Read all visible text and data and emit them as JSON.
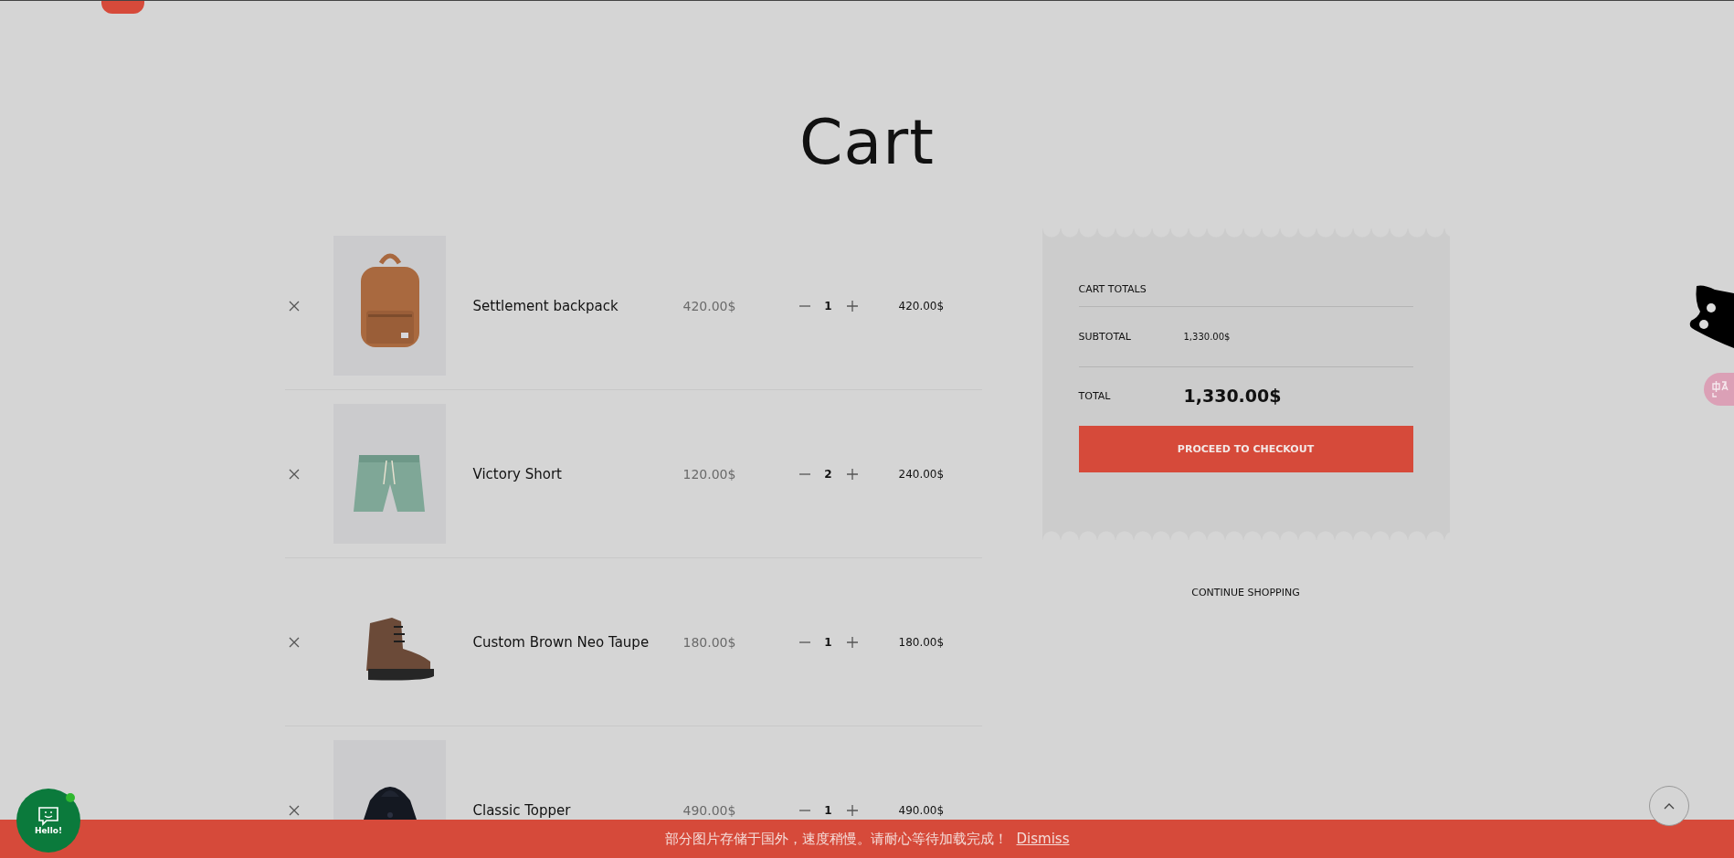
{
  "page": {
    "title": "Cart"
  },
  "cart_items": [
    {
      "name": "Settlement backpack",
      "price": "420.00$",
      "quantity": "1",
      "subtotal": "420.00$"
    },
    {
      "name": "Victory Short",
      "price": "120.00$",
      "quantity": "2",
      "subtotal": "240.00$"
    },
    {
      "name": "Custom Brown Neo Taupe",
      "price": "180.00$",
      "quantity": "1",
      "subtotal": "180.00$"
    },
    {
      "name": "Classic Topper",
      "price": "490.00$",
      "quantity": "1",
      "subtotal": "490.00$"
    }
  ],
  "totals": {
    "heading": "CART TOTALS",
    "subtotal_label": "SUBTOTAL",
    "subtotal": "1,330.00$",
    "total_label": "TOTAL",
    "total": "1,330.00$",
    "checkout_button": "PROCEED TO CHECKOUT"
  },
  "continue_shopping": "CONTINUE SHOPPING",
  "notice_bar": {
    "message": "部分图片存储于国外，速度稍慢。请耐心等待加载完成！",
    "dismiss": "Dismiss"
  },
  "chat_widget": {
    "label": "Hello!"
  }
}
